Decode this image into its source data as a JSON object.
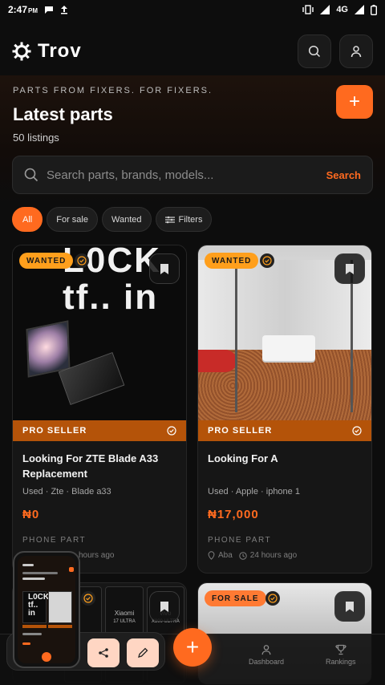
{
  "status_bar": {
    "time": "2:47",
    "ampm": "PM",
    "network": "4G"
  },
  "header": {
    "app_name": "Trov",
    "logo_icon": "gear-logo-icon"
  },
  "hero": {
    "tagline": "PARTS FROM FIXERS. FOR FIXERS.",
    "title": "Latest parts",
    "count": "50 listings",
    "add_label": "+"
  },
  "search": {
    "placeholder": "Search parts, brands, models...",
    "action": "Search"
  },
  "filters": [
    {
      "label": "All"
    },
    {
      "label": "For sale"
    },
    {
      "label": "Wanted"
    },
    {
      "label": "Filters"
    }
  ],
  "listings": [
    {
      "badge": "WANTED",
      "big_text_1": "L0CK",
      "big_text_2": "tf.. in",
      "pro": "PRO SELLER",
      "title": "Looking For ZTE Blade A33 Replacement",
      "meta": "Used · Zte · Blade a33",
      "price": "₦0",
      "category": "PHONE PART",
      "location": "",
      "time": "hours ago"
    },
    {
      "badge": "WANTED",
      "pro": "PRO SELLER",
      "title": "Looking For A",
      "meta": "Used · Apple · iphone 1",
      "price": "₦17,000",
      "category": "PHONE PART",
      "location": "Aba",
      "time": "24 hours ago"
    },
    {
      "badge": "",
      "speaker_labels": [
        "Xiaomi",
        "vivo"
      ],
      "speaker_sub": [
        "17 ULTRA",
        "X300 ULTRA"
      ]
    },
    {
      "badge": "FOR SALE"
    }
  ],
  "mini_phone": {
    "big_text_1": "L0CK",
    "big_text_2": "tf.. in"
  },
  "nav": {
    "dashboard": "Dashboard",
    "rankings": "Rankings",
    "fab": "+"
  },
  "colors": {
    "accent": "#ff6a1f",
    "pro_bar": "#b45309",
    "wanted": "#ff9f1c"
  }
}
